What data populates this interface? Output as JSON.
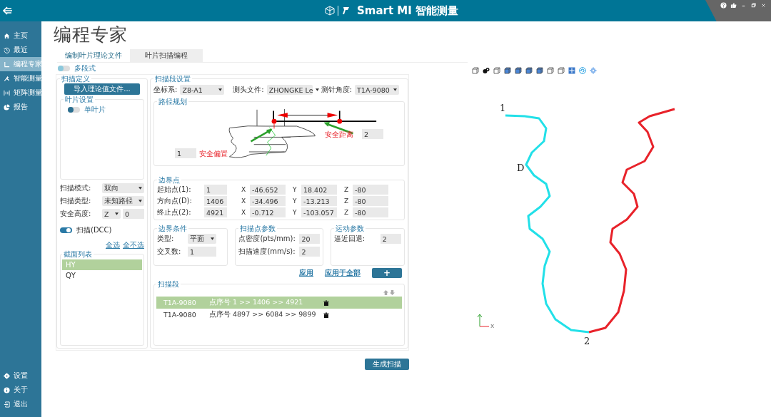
{
  "window": {
    "title": "Smart MI 智能测量"
  },
  "sidebar": {
    "items": [
      {
        "label": "主页",
        "selected": false
      },
      {
        "label": "最近",
        "selected": false
      },
      {
        "label": "编程专家",
        "selected": true
      },
      {
        "label": "智能测量",
        "selected": false
      },
      {
        "label": "矩阵测量",
        "selected": false
      },
      {
        "label": "报告",
        "selected": false
      }
    ],
    "bottom_items": [
      {
        "label": "设置",
        "selected": false
      },
      {
        "label": "关于",
        "selected": false
      },
      {
        "label": "退出",
        "selected": false
      }
    ]
  },
  "page_title": "编程专家",
  "tabs": [
    {
      "label": "编制叶片理论文件",
      "selected": false
    },
    {
      "label": "叶片扫描编程",
      "selected": true
    }
  ],
  "multi_segment": {
    "label": "多段式",
    "on": false
  },
  "scan_definition": {
    "title": "扫描定义",
    "import_button": "导入理论值文件...",
    "blade_settings": {
      "title": "叶片设置",
      "single_blade": {
        "label": "单叶片",
        "on": false
      }
    },
    "fields": [
      {
        "label": "扫描模式:",
        "value": "双向"
      },
      {
        "label": "扫描类型:",
        "value": "未知路径"
      }
    ],
    "safety_height": {
      "label": "安全高度:",
      "axis": "Z",
      "value": "0"
    },
    "dcc": {
      "label": "扫描(DCC)",
      "on": true
    },
    "select_all": "全选",
    "select_none": "全不选",
    "section_list": {
      "title": "截面列表",
      "items": [
        {
          "label": "HY",
          "selected": true
        },
        {
          "label": "QY",
          "selected": false
        }
      ]
    }
  },
  "segment_settings": {
    "title": "扫描段设置",
    "selects": [
      {
        "label": "坐标系:",
        "value": "Z8-A1"
      },
      {
        "label": "测头文件:",
        "value": "ZHONGKE Le"
      },
      {
        "label": "测针角度:",
        "value": "T1A-9080"
      }
    ],
    "path_planning": {
      "title": "路径规划",
      "safety_offset": {
        "label": "安全偏置",
        "value": "1"
      },
      "safety_distance": {
        "label": "安全距离",
        "value": "2"
      }
    },
    "boundary_points": {
      "title": "边界点",
      "rows": [
        {
          "label": "起始点(1):",
          "index": "1",
          "coords": [
            {
              "axis": "X",
              "value": "-46.652"
            },
            {
              "axis": "Y",
              "value": "18.402"
            },
            {
              "axis": "Z",
              "value": "-80"
            }
          ]
        },
        {
          "label": "方向点(D):",
          "index": "1406",
          "coords": [
            {
              "axis": "X",
              "value": "-34.496"
            },
            {
              "axis": "Y",
              "value": "-13.213"
            },
            {
              "axis": "Z",
              "value": "-80"
            }
          ]
        },
        {
          "label": "终止点(2):",
          "index": "4921",
          "coords": [
            {
              "axis": "X",
              "value": "-0.712"
            },
            {
              "axis": "Y",
              "value": "-103.057"
            },
            {
              "axis": "Z",
              "value": "-80"
            }
          ]
        }
      ]
    },
    "boundary_conditions": {
      "title": "边界条件",
      "type": {
        "label": "类型:",
        "value": "平面"
      },
      "crossings": {
        "label": "交叉数:",
        "value": "1"
      }
    },
    "scan_point_params": {
      "title": "扫描点参数",
      "fields": [
        {
          "label": "点密度(pts/mm):",
          "value": "20"
        },
        {
          "label": "扫描速度(mm/s):",
          "value": "2"
        }
      ]
    },
    "motion_params": {
      "title": "运动参数",
      "fields": [
        {
          "label": "逼近回退:",
          "value": "2"
        }
      ]
    },
    "apply": "应用",
    "apply_all": "应用于全部",
    "add_button": "+",
    "scan_segments": {
      "title": "扫描段",
      "rows": [
        {
          "probe": "T1A-9080",
          "points": "点序号 1 >> 1406 >> 4921",
          "selected": true
        },
        {
          "probe": "T1A-9080",
          "points": "点序号 4897 >> 6084 >> 9899",
          "selected": false
        }
      ]
    }
  },
  "generate_button": "生成扫描",
  "viewer": {
    "labels": [
      "1",
      "D",
      "2"
    ],
    "axis_label": "x"
  }
}
